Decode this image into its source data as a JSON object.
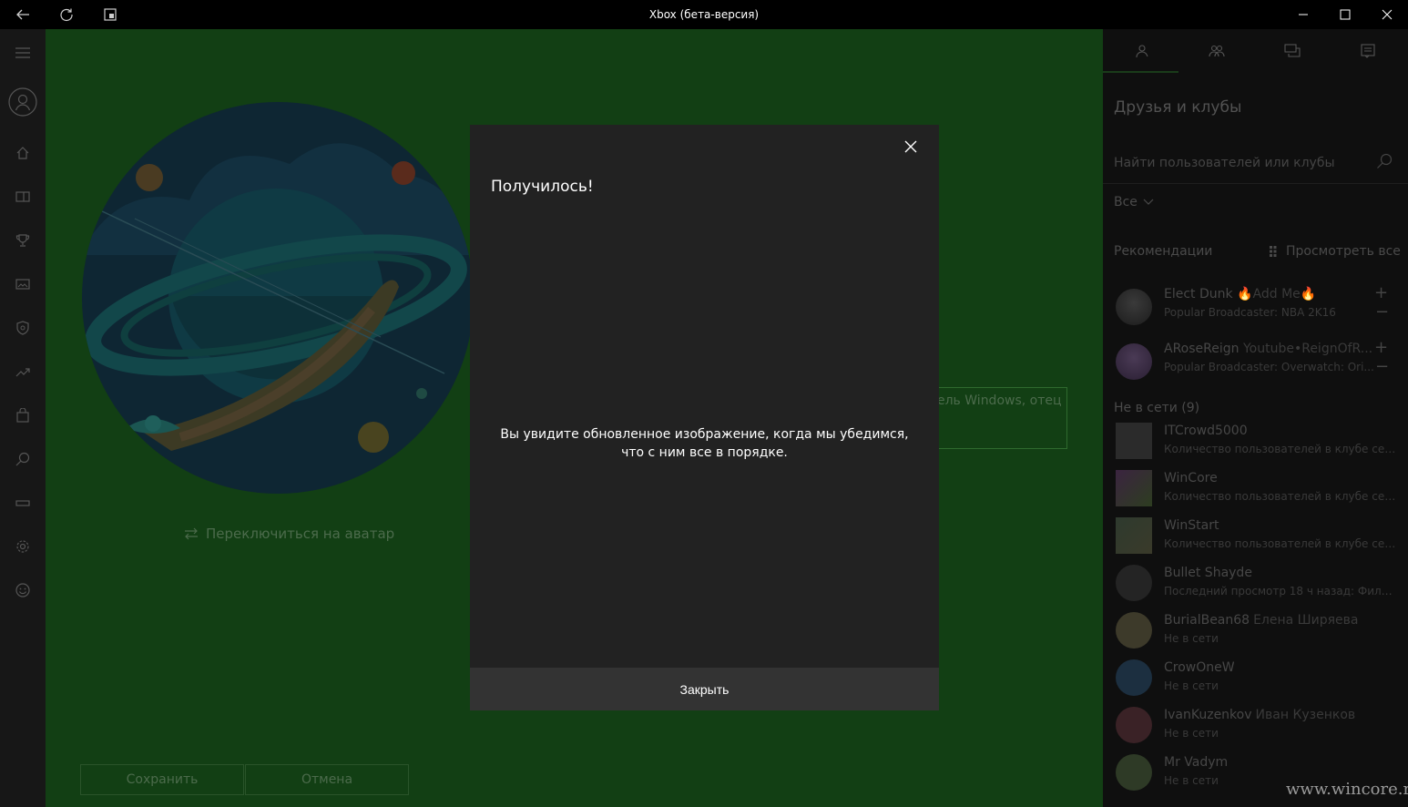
{
  "window": {
    "title": "Xbox (бета-версия)"
  },
  "main": {
    "switch_avatar_label": "Переключиться на аватар",
    "bio_text": "ель Windows, отец",
    "save_label": "Сохранить",
    "cancel_label": "Отмена"
  },
  "panel": {
    "title": "Друзья и клубы",
    "search_placeholder": "Найти пользователей или клубы",
    "filter_label": "Все",
    "recommendations_label": "Рекомендации",
    "view_all_label": "Просмотреть все",
    "recommendations": [
      {
        "name": "Elect Dunk",
        "extra": "🔥Add Me🔥",
        "sub": "Popular Broadcaster: NBA 2K16"
      },
      {
        "name": "ARoseReign",
        "extra": "Youtube•ReignOfR...",
        "sub": "Popular Broadcaster: Overwatch: Ori..."
      }
    ],
    "offline_label": "Не в сети (9)",
    "friends": [
      {
        "name": "ITCrowd5000",
        "real": "",
        "sub": "Количество пользователей в клубе сейч..."
      },
      {
        "name": "WinCore",
        "real": "",
        "sub": "Количество пользователей в клубе сейч..."
      },
      {
        "name": "WinStart",
        "real": "",
        "sub": "Количество пользователей в клубе сейч..."
      },
      {
        "name": "Bullet Shayde",
        "real": "",
        "sub": "Последний просмотр 18 ч назад: Фильм..."
      },
      {
        "name": "BurialBean68",
        "real": "Елена Ширяева",
        "sub": "Не в сети"
      },
      {
        "name": "CrowOneW",
        "real": "",
        "sub": "Не в сети"
      },
      {
        "name": "IvanKuzenkov",
        "real": "Иван Кузенков",
        "sub": "Не в сети"
      },
      {
        "name": "Mr Vadym",
        "real": "",
        "sub": "Не в сети"
      }
    ]
  },
  "dialog": {
    "title": "Получилось!",
    "message": "Вы увидите обновленное изображение, когда мы убедимся, что с ним все в порядке.",
    "close_button_label": "Закрыть"
  },
  "watermark": "www.wincore.ru"
}
